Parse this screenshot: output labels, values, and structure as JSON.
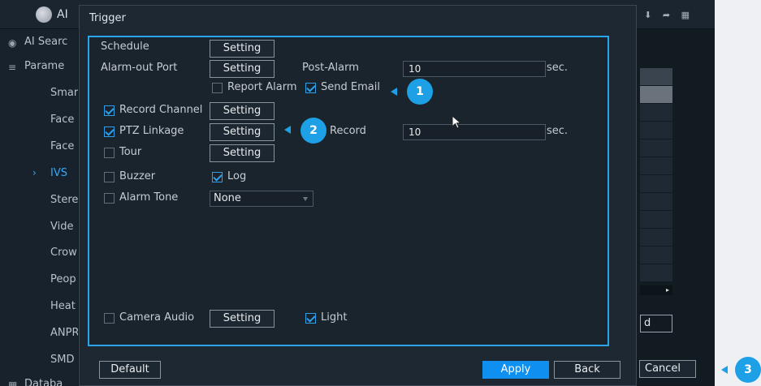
{
  "app": {
    "title": "AI",
    "right_icons": "⬇ ➦ ▦"
  },
  "sidebar": [
    {
      "label": "AI Searc",
      "icon": "search-icon"
    },
    {
      "label": "Parame",
      "icon": "list-icon"
    },
    {
      "label": "Smar"
    },
    {
      "label": "Face"
    },
    {
      "label": "Face"
    },
    {
      "label": "IVS",
      "active": true
    },
    {
      "label": "Stere"
    },
    {
      "label": "Vide"
    },
    {
      "label": "Crow"
    },
    {
      "label": "Peop"
    },
    {
      "label": "Heat"
    },
    {
      "label": "ANPR"
    },
    {
      "label": "SMD"
    },
    {
      "label": "Databa",
      "icon": "database-icon"
    }
  ],
  "background": {
    "field_text": "d",
    "cancel_label": "Cancel"
  },
  "dialog": {
    "title": "Trigger",
    "schedule": {
      "label": "Schedule",
      "button": "Setting"
    },
    "alarm_out": {
      "label": "Alarm-out Port",
      "button": "Setting"
    },
    "post_alarm": {
      "label": "Post-Alarm",
      "value": "10",
      "unit": "sec."
    },
    "report_alarm": {
      "label": "Report Alarm",
      "checked": false
    },
    "send_email": {
      "label": "Send Email",
      "checked": true
    },
    "record_channel": {
      "label": "Record Channel",
      "checked": true,
      "button": "Setting"
    },
    "ptz_linkage": {
      "label": "PTZ Linkage",
      "checked": true,
      "button": "Setting"
    },
    "post_record": {
      "label": "Record",
      "value": "10",
      "unit": "sec."
    },
    "tour": {
      "label": "Tour",
      "checked": false,
      "button": "Setting"
    },
    "buzzer": {
      "label": "Buzzer",
      "checked": false
    },
    "log": {
      "label": "Log",
      "checked": true
    },
    "alarm_tone": {
      "label": "Alarm Tone",
      "checked": false,
      "value": "None"
    },
    "camera_audio": {
      "label": "Camera Audio",
      "checked": false,
      "button": "Setting"
    },
    "light": {
      "label": "Light",
      "checked": true
    },
    "footer": {
      "default": "Default",
      "apply": "Apply",
      "back": "Back"
    }
  },
  "callouts": [
    "1",
    "2",
    "3"
  ],
  "colors": {
    "accent": "#1ea0e6",
    "apply": "#0f8ff0"
  }
}
